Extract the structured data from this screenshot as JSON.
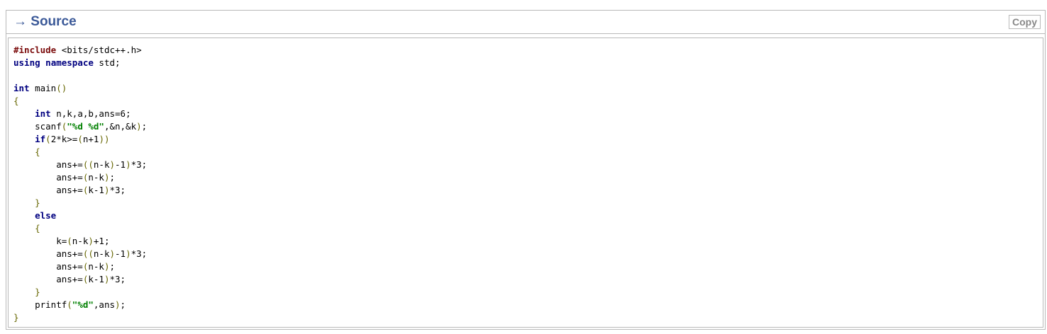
{
  "header": {
    "title": "→ Source",
    "copy_label": "Copy"
  },
  "code": {
    "language": "cpp",
    "lines": [
      [
        {
          "t": "#include",
          "c": "pre"
        },
        {
          "t": " <bits/stdc++.h>",
          "c": ""
        }
      ],
      [
        {
          "t": "using",
          "c": "kw"
        },
        {
          "t": " ",
          "c": ""
        },
        {
          "t": "namespace",
          "c": "kw"
        },
        {
          "t": " std;",
          "c": ""
        }
      ],
      [],
      [
        {
          "t": "int",
          "c": "kw"
        },
        {
          "t": " main",
          "c": ""
        },
        {
          "t": "()",
          "c": "p"
        }
      ],
      [
        {
          "t": "{",
          "c": "p"
        }
      ],
      [
        {
          "t": "    ",
          "c": ""
        },
        {
          "t": "int",
          "c": "kw"
        },
        {
          "t": " n,k,a,b,ans=6;",
          "c": ""
        }
      ],
      [
        {
          "t": "    scanf",
          "c": ""
        },
        {
          "t": "(",
          "c": "p"
        },
        {
          "t": "\"%d %d\"",
          "c": "str"
        },
        {
          "t": ",&n,&k",
          "c": ""
        },
        {
          "t": ")",
          "c": "p"
        },
        {
          "t": ";",
          "c": ""
        }
      ],
      [
        {
          "t": "    ",
          "c": ""
        },
        {
          "t": "if",
          "c": "kw"
        },
        {
          "t": "(",
          "c": "p"
        },
        {
          "t": "2*k>=",
          "c": ""
        },
        {
          "t": "(",
          "c": "p"
        },
        {
          "t": "n+1",
          "c": ""
        },
        {
          "t": "))",
          "c": "p"
        }
      ],
      [
        {
          "t": "    ",
          "c": ""
        },
        {
          "t": "{",
          "c": "p"
        }
      ],
      [
        {
          "t": "        ans+=",
          "c": ""
        },
        {
          "t": "((",
          "c": "p"
        },
        {
          "t": "n-k",
          "c": ""
        },
        {
          "t": ")",
          "c": "p"
        },
        {
          "t": "-1",
          "c": ""
        },
        {
          "t": ")",
          "c": "p"
        },
        {
          "t": "*3;",
          "c": ""
        }
      ],
      [
        {
          "t": "        ans+=",
          "c": ""
        },
        {
          "t": "(",
          "c": "p"
        },
        {
          "t": "n-k",
          "c": ""
        },
        {
          "t": ")",
          "c": "p"
        },
        {
          "t": ";",
          "c": ""
        }
      ],
      [
        {
          "t": "        ans+=",
          "c": ""
        },
        {
          "t": "(",
          "c": "p"
        },
        {
          "t": "k-1",
          "c": ""
        },
        {
          "t": ")",
          "c": "p"
        },
        {
          "t": "*3;",
          "c": ""
        }
      ],
      [
        {
          "t": "    ",
          "c": ""
        },
        {
          "t": "}",
          "c": "p"
        }
      ],
      [
        {
          "t": "    ",
          "c": ""
        },
        {
          "t": "else",
          "c": "kw"
        }
      ],
      [
        {
          "t": "    ",
          "c": ""
        },
        {
          "t": "{",
          "c": "p"
        }
      ],
      [
        {
          "t": "        k=",
          "c": ""
        },
        {
          "t": "(",
          "c": "p"
        },
        {
          "t": "n-k",
          "c": ""
        },
        {
          "t": ")",
          "c": "p"
        },
        {
          "t": "+1;",
          "c": ""
        }
      ],
      [
        {
          "t": "        ans+=",
          "c": ""
        },
        {
          "t": "((",
          "c": "p"
        },
        {
          "t": "n-k",
          "c": ""
        },
        {
          "t": ")",
          "c": "p"
        },
        {
          "t": "-1",
          "c": ""
        },
        {
          "t": ")",
          "c": "p"
        },
        {
          "t": "*3;",
          "c": ""
        }
      ],
      [
        {
          "t": "        ans+=",
          "c": ""
        },
        {
          "t": "(",
          "c": "p"
        },
        {
          "t": "n-k",
          "c": ""
        },
        {
          "t": ")",
          "c": "p"
        },
        {
          "t": ";",
          "c": ""
        }
      ],
      [
        {
          "t": "        ans+=",
          "c": ""
        },
        {
          "t": "(",
          "c": "p"
        },
        {
          "t": "k-1",
          "c": ""
        },
        {
          "t": ")",
          "c": "p"
        },
        {
          "t": "*3;",
          "c": ""
        }
      ],
      [
        {
          "t": "    ",
          "c": ""
        },
        {
          "t": "}",
          "c": "p"
        }
      ],
      [
        {
          "t": "    printf",
          "c": ""
        },
        {
          "t": "(",
          "c": "p"
        },
        {
          "t": "\"%d\"",
          "c": "str"
        },
        {
          "t": ",ans",
          "c": ""
        },
        {
          "t": ")",
          "c": "p"
        },
        {
          "t": ";",
          "c": ""
        }
      ],
      [
        {
          "t": "}",
          "c": "p"
        }
      ]
    ]
  },
  "colors": {
    "title": "#3b5998",
    "preprocessor": "#7a0a0a",
    "keyword": "#000080",
    "string": "#008000",
    "punctuation": "#666600",
    "border": "#b9b9b9"
  }
}
